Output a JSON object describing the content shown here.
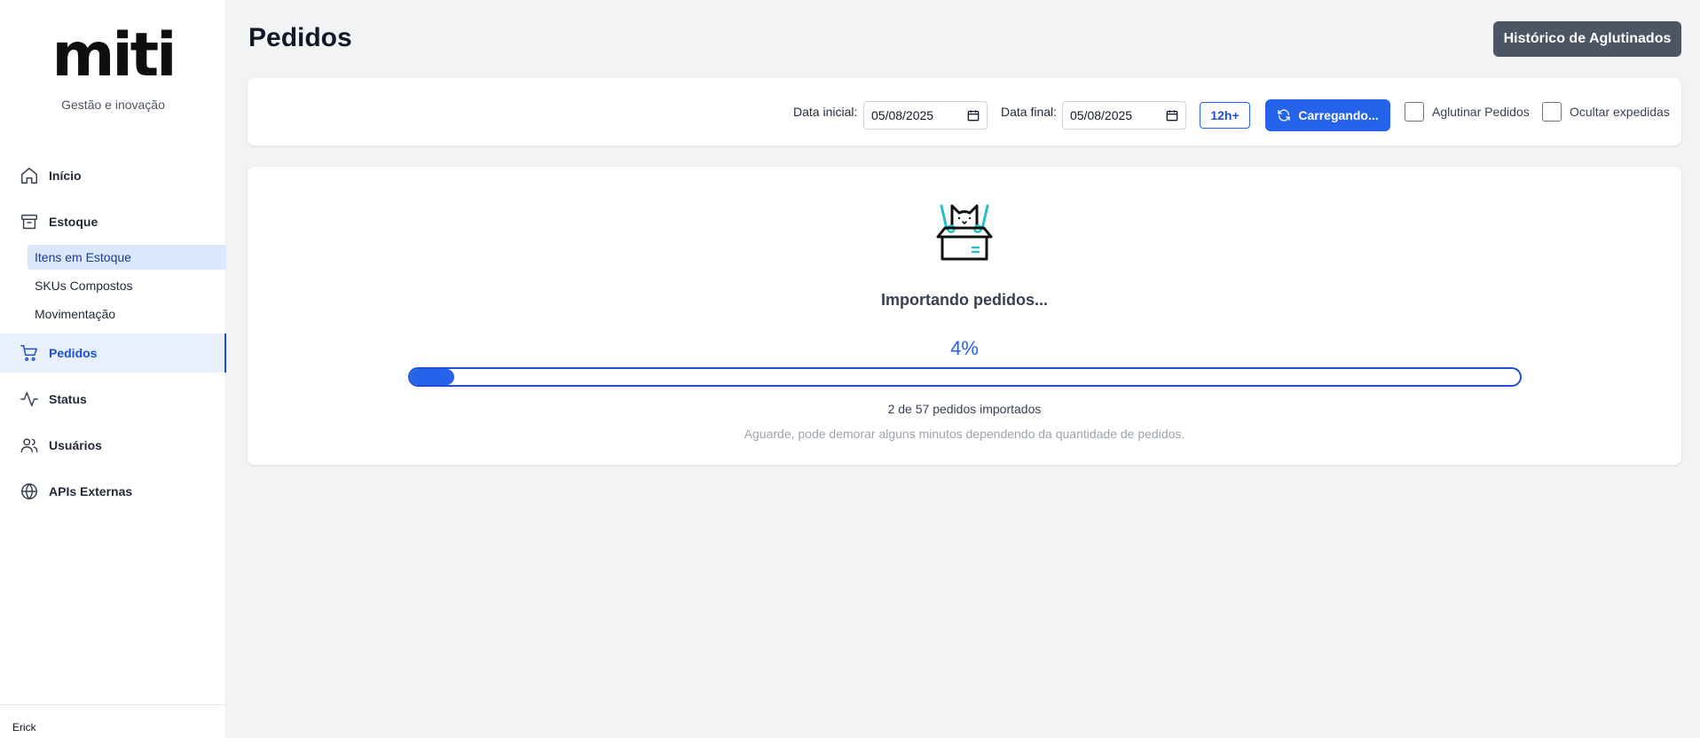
{
  "app": {
    "logo_text": "miti",
    "tagline": "Gestão e inovação",
    "user": "Erick"
  },
  "sidebar": {
    "items": [
      {
        "label": "Início",
        "icon": "home-icon"
      },
      {
        "label": "Estoque",
        "icon": "archive-icon"
      },
      {
        "label": "Pedidos",
        "icon": "cart-icon",
        "active": true
      },
      {
        "label": "Status",
        "icon": "activity-icon"
      },
      {
        "label": "Usuários",
        "icon": "users-icon"
      },
      {
        "label": "APIs Externas",
        "icon": "globe-icon"
      }
    ],
    "subitems": [
      {
        "label": "Itens em Estoque",
        "active": true
      },
      {
        "label": "SKUs Compostos"
      },
      {
        "label": "Movimentação"
      }
    ]
  },
  "header": {
    "title": "Pedidos",
    "history_button": "Histórico de Aglutinados"
  },
  "toolbar": {
    "start_label": "Data inicial:",
    "start_value": "05/08/2025",
    "end_label": "Data final:",
    "end_value": "05/08/2025",
    "btn_12h": "12h+",
    "loading_button": "Carregando...",
    "chk_aglutinar": "Aglutinar Pedidos",
    "chk_ocultar": "Ocultar expedidas"
  },
  "progress": {
    "title": "Importando pedidos...",
    "percent_text": "4%",
    "fraction": 0.04,
    "count_text": "2 de 57 pedidos importados",
    "hint": "Aguarde, pode demorar alguns minutos dependendo da quantidade de pedidos."
  },
  "colors": {
    "accent": "#2563eb",
    "active_bg": "#e8f0fc",
    "history_btn": "#4b5563"
  }
}
